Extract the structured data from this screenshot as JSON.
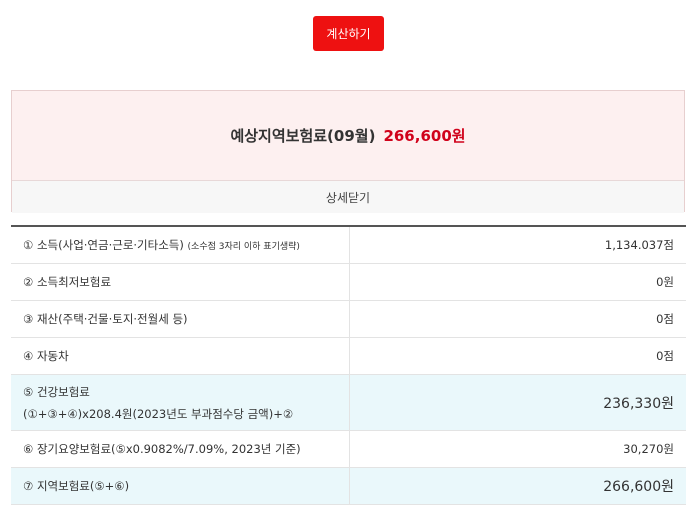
{
  "calc_button": "계산하기",
  "result": {
    "label": "예상지역보험료(09월)",
    "amount": "266,600원",
    "toggle_label": "상세닫기"
  },
  "rows": [
    {
      "label": "① 소득(사업·연금·근로·기타소득)",
      "note": "(소수점 3자리 이하 표기생략)",
      "value": "1,134.037점"
    },
    {
      "label": "② 소득최저보험료",
      "value": "0원"
    },
    {
      "label": "③ 재산(주택·건물·토지·전월세 등)",
      "value": "0점"
    },
    {
      "label": "④ 자동차",
      "value": "0점"
    },
    {
      "label": "⑤ 건강보험료",
      "label2": "(①+③+④)x208.4원(2023년도 부과점수당 금액)+②",
      "value": "236,330원"
    },
    {
      "label": "⑥ 장기요양보험료(⑤x0.9082%/7.09%, 2023년 기준)",
      "value": "30,270원"
    },
    {
      "label": "⑦ 지역보험료(⑤+⑥)",
      "value": "266,600원"
    }
  ]
}
